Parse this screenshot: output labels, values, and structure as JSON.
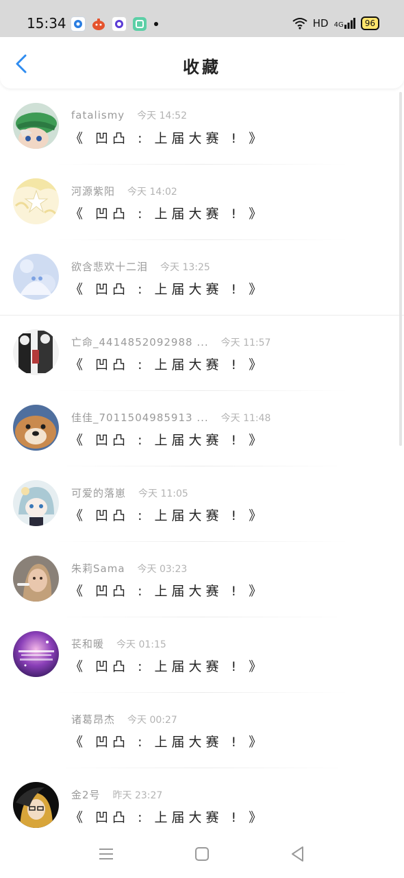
{
  "status_bar": {
    "time": "15:34",
    "network": "HD",
    "signal": "4G",
    "battery": "96",
    "app_icons": [
      "notification-app-blue-icon",
      "notification-app-red-icon",
      "notification-app-purple-icon",
      "notification-app-green-icon"
    ]
  },
  "header": {
    "title": "收藏",
    "back_icon": "chevron-left-icon"
  },
  "colors": {
    "accent": "#2f8cf0",
    "status_bar_bg": "#d9d9d9",
    "text_primary": "#222222",
    "text_secondary": "#9a9a9a"
  },
  "favorites": [
    {
      "name": "fatalismy",
      "time": "今天 14:52",
      "content": "《 凹凸 : 上届大赛 ! 》"
    },
    {
      "name": "河源紫阳",
      "time": "今天 14:02",
      "content": "《 凹凸 : 上届大赛 ! 》"
    },
    {
      "name": "欲含悲欢十二泪",
      "time": "今天 13:25",
      "content": "《 凹凸 : 上届大赛 ! 》"
    },
    {
      "name": "亡命_4414852092988 ...",
      "time": "今天 11:57",
      "content": "《 凹凸 : 上届大赛 ! 》"
    },
    {
      "name": "佳佳_7011504985913 ...",
      "time": "今天 11:48",
      "content": "《 凹凸 : 上届大赛 ! 》"
    },
    {
      "name": "可爱的落崽",
      "time": "今天 11:05",
      "content": "《 凹凸 : 上届大赛 ! 》"
    },
    {
      "name": "朱莉Sama",
      "time": "今天 03:23",
      "content": "《 凹凸 : 上届大赛 ! 》"
    },
    {
      "name": "苌和暖",
      "time": "今天 01:15",
      "content": "《 凹凸 : 上届大赛 ! 》"
    },
    {
      "name": "诸葛昂杰",
      "time": "今天 00:27",
      "content": "《 凹凸 : 上届大赛 ! 》"
    },
    {
      "name": "金2号",
      "time": "昨天 23:27",
      "content": "《 凹凸 : 上届大赛 ! 》"
    }
  ],
  "nav_bar": {
    "menu_icon": "menu-icon",
    "home_icon": "home-square-icon",
    "back_icon": "back-triangle-icon"
  }
}
